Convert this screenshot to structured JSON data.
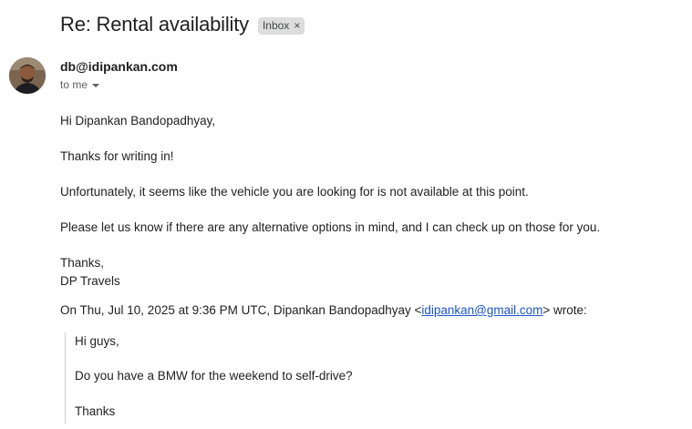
{
  "message": {
    "subject": "Re: Rental availability",
    "label": "Inbox",
    "label_remove_icon": "close-icon",
    "sender_email": "db@idipankan.com",
    "recipient_text": "to me",
    "recipient_icon": "chevron-down-icon",
    "avatar_icon": "avatar-photo"
  },
  "body": {
    "greeting": "Hi Dipankan Bandopadhyay,",
    "line1": "Thanks for writing in!",
    "line2": "Unfortunately, it seems like the vehicle you are looking for is not available at this point.",
    "line3": "Please let us know if there are any alternative options in mind, and I can check up on those for you.",
    "signoff": "Thanks,",
    "signature": "DP Travels"
  },
  "quote": {
    "header_prefix": "On Thu, Jul 10, 2025 at 9:36 PM UTC, Dipankan Bandopadhyay <",
    "header_email": "idipankan@gmail.com",
    "header_suffix": "> wrote:",
    "line1": "Hi guys,",
    "line2": "Do you have a BMW for the weekend to self-drive?",
    "line3": "Thanks"
  },
  "colors": {
    "link": "#1a55c7",
    "chip_bg": "#dddddd",
    "quote_bar": "#cccccc"
  }
}
